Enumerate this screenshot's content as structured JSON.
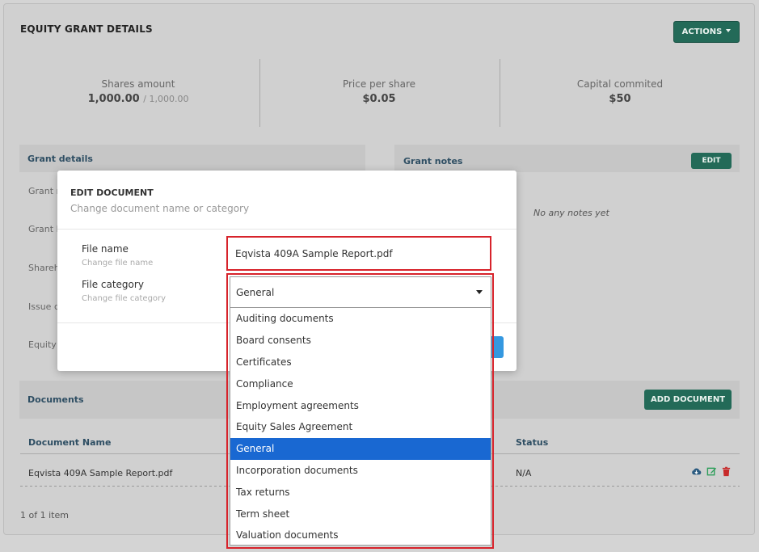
{
  "page": {
    "title": "EQUITY GRANT DETAILS",
    "actions_label": "ACTIONS"
  },
  "stats": [
    {
      "label": "Shares amount",
      "value": "1,000.00",
      "sub": "/ 1,000.00"
    },
    {
      "label": "Price per share",
      "value": "$0.05"
    },
    {
      "label": "Capital commited",
      "value": "$50"
    }
  ],
  "grant_details": {
    "heading": "Grant details",
    "rows": [
      "Grant n",
      "Grant I",
      "Shareh",
      "Issue d",
      "Equity"
    ]
  },
  "grant_notes": {
    "heading": "Grant notes",
    "edit_label": "EDIT",
    "empty_text": "No any notes yet"
  },
  "documents": {
    "heading": "Documents",
    "add_label": "ADD DOCUMENT",
    "columns": {
      "name": "Document Name",
      "status": "Status"
    },
    "rows": [
      {
        "name": "Eqvista 409A Sample Report.pdf",
        "status": "N/A"
      }
    ],
    "pager": "1 of 1 item"
  },
  "modal": {
    "title": "EDIT DOCUMENT",
    "subtitle": "Change document name or category",
    "file_name_label": "File name",
    "file_name_help": "Change file name",
    "file_name_value": "Eqvista 409A Sample Report.pdf",
    "file_category_label": "File category",
    "file_category_help": "Change file category",
    "file_category_value": "General",
    "options": [
      "Auditing documents",
      "Board consents",
      "Certificates",
      "Compliance",
      "Employment agreements",
      "Equity Sales Agreement",
      "General",
      "Incorporation documents",
      "Tax returns",
      "Term sheet",
      "Valuation documents"
    ],
    "selected_index": 6
  },
  "colors": {
    "accent": "#236a58",
    "highlight": "#d7232b",
    "selected": "#1968d2"
  }
}
